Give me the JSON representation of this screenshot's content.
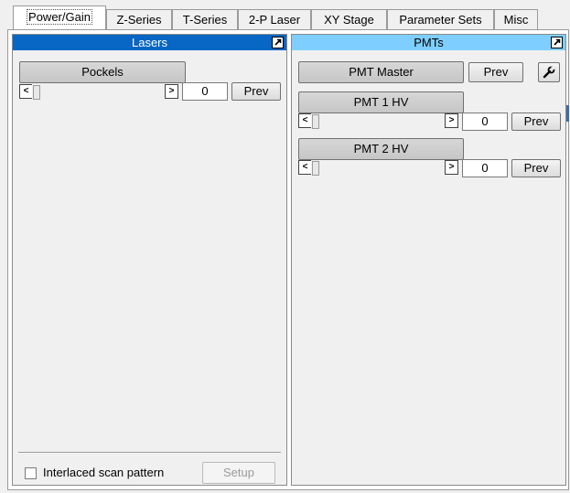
{
  "tabs": [
    "Power/Gain",
    "Z-Series",
    "T-Series",
    "2-P Laser",
    "XY Stage",
    "Parameter Sets",
    "Misc"
  ],
  "colors": {
    "lasers_header": "#0866c4",
    "pmts_header": "#7ecfff"
  },
  "lasers": {
    "title": "Lasers",
    "pockels": {
      "label": "Pockels",
      "value": "0",
      "prev": "Prev"
    },
    "interlaced_label": "Interlaced scan pattern",
    "setup": "Setup"
  },
  "pmts": {
    "title": "PMTs",
    "master": {
      "label": "PMT Master",
      "prev": "Prev"
    },
    "pmt1": {
      "label": "PMT 1 HV",
      "value": "0",
      "prev": "Prev"
    },
    "pmt2": {
      "label": "PMT 2 HV",
      "value": "0",
      "prev": "Prev"
    }
  },
  "icons": {
    "popout": "popout-icon",
    "settings": "wrench-icon",
    "left": "arrow-left-icon",
    "right": "arrow-right-icon"
  }
}
